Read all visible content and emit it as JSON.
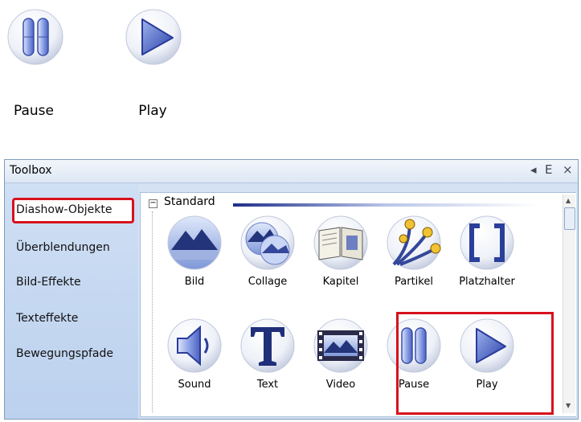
{
  "top_buttons": [
    {
      "label": "Pause",
      "icon": "pause-icon"
    },
    {
      "label": "Play",
      "icon": "play-icon"
    }
  ],
  "toolbox": {
    "title": "Toolbox",
    "controls": [
      "◂",
      "ⴹ",
      "×"
    ],
    "categories": [
      {
        "label": "Diashow-Objekte",
        "selected": true
      },
      {
        "label": "Überblendungen"
      },
      {
        "label": "Bild-Effekte"
      },
      {
        "label": "Texteffekte"
      },
      {
        "label": "Bewegungspfade"
      }
    ],
    "group": {
      "toggle": "−",
      "label": "Standard"
    },
    "items": [
      {
        "label": "Bild",
        "icon": "mountain-icon"
      },
      {
        "label": "Collage",
        "icon": "collage-icon"
      },
      {
        "label": "Kapitel",
        "icon": "book-icon"
      },
      {
        "label": "Partikel",
        "icon": "particle-icon"
      },
      {
        "label": "Platzhalter",
        "icon": "brackets-icon"
      },
      {
        "label": "Sound",
        "icon": "speaker-icon"
      },
      {
        "label": "Text",
        "icon": "text-t-icon"
      },
      {
        "label": "Video",
        "icon": "film-icon"
      },
      {
        "label": "Pause",
        "icon": "pause-icon"
      },
      {
        "label": "Play",
        "icon": "play-icon"
      }
    ],
    "accent_color": "#d8111d"
  }
}
